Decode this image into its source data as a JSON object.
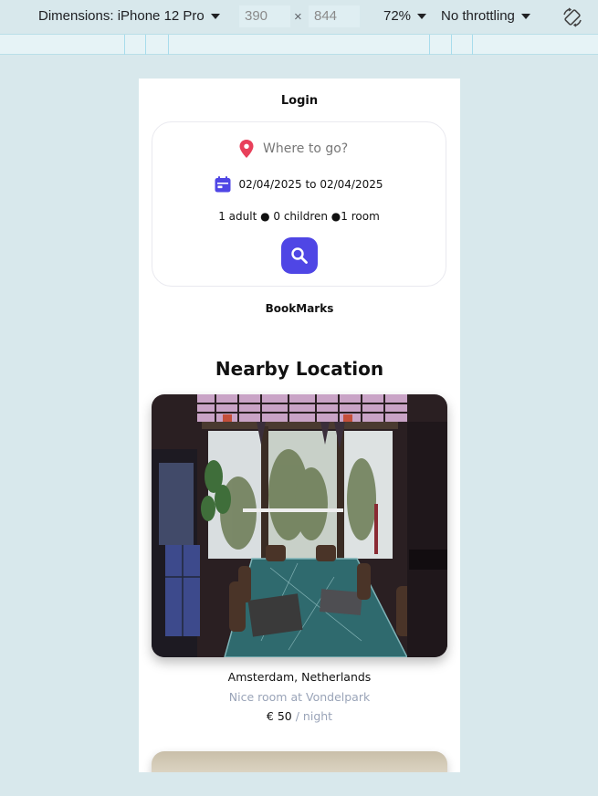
{
  "devtools": {
    "device_label": "Dimensions: iPhone 12 Pro",
    "width": "390",
    "times": "×",
    "height": "844",
    "zoom": "72%",
    "throttling": "No throttling",
    "icons": [
      "caret-down-icon",
      "rotate-icon"
    ]
  },
  "header": {
    "login_label": "Login"
  },
  "search": {
    "placeholder": "Where to go?",
    "date_from": "02/04/2025",
    "date_to_word": "to",
    "date_to": "02/04/2025",
    "guests": "1 adult ● 0 children ●1 room",
    "icons": {
      "location": "map-pin-icon",
      "calendar": "calendar-icon",
      "search": "search-icon"
    },
    "accent": "#4f46e5",
    "pin_color": "#e8405a"
  },
  "bookmarks_label": "BookMarks",
  "section_title": "Nearby Location",
  "listings": [
    {
      "location": "Amsterdam, Netherlands",
      "description": "Nice room at Vondelpark",
      "price": "€ 50",
      "per": "/ night"
    }
  ]
}
